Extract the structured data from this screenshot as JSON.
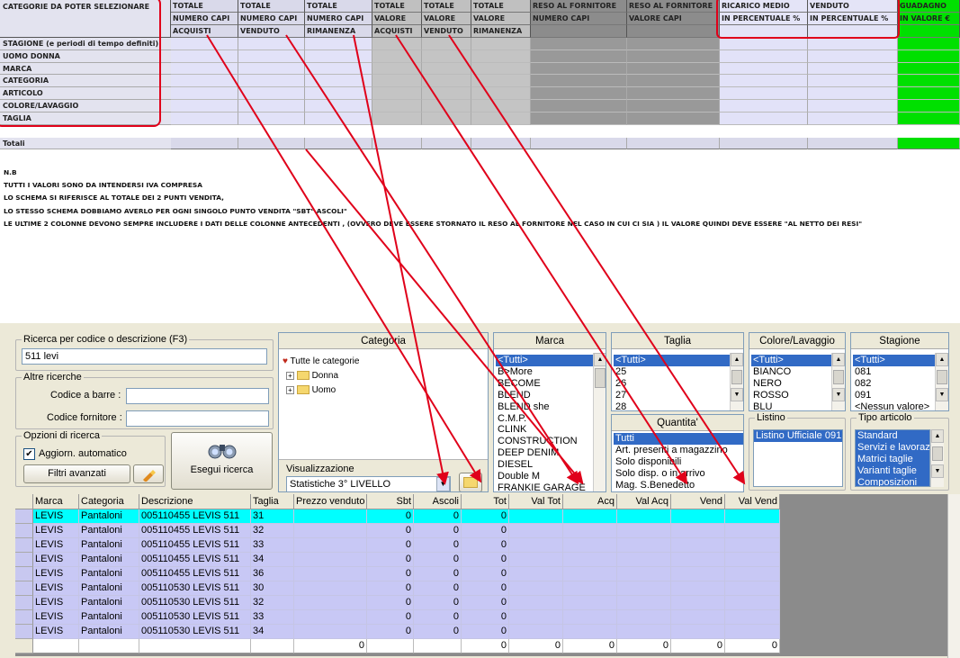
{
  "sheet": {
    "header_label": "CATEGORIE DA POTER SELEZIONARE",
    "columns": [
      {
        "l1": "TOTALE",
        "l2": "NUMERO CAPI",
        "l3": "ACQUISTI"
      },
      {
        "l1": "TOTALE",
        "l2": "NUMERO CAPI",
        "l3": "VENDUTO"
      },
      {
        "l1": "TOTALE",
        "l2": "NUMERO CAPI",
        "l3": "RIMANENZA"
      },
      {
        "l1": "TOTALE",
        "l2": "VALORE",
        "l3": "ACQUISTI"
      },
      {
        "l1": "TOTALE",
        "l2": "VALORE",
        "l3": "VENDUTO"
      },
      {
        "l1": "TOTALE",
        "l2": "VALORE",
        "l3": "RIMANENZA"
      },
      {
        "l1": "RESO AL FORNITORE",
        "l2": "NUMERO CAPI",
        "l3": ""
      },
      {
        "l1": "RESO AL FORNITORE",
        "l2": "VALORE CAPI",
        "l3": ""
      },
      {
        "l1": "RICARICO MEDIO",
        "l2": "IN PERCENTUALE %",
        "l3": ""
      },
      {
        "l1": "VENDUTO",
        "l2": "IN PERCENTUALE %",
        "l3": ""
      },
      {
        "l1": "GUADAGNO",
        "l2": "IN VALORE €",
        "l3": ""
      }
    ],
    "rows": [
      "STAGIONE (e periodi di tempo definiti)",
      "UOMO DONNA",
      "MARCA",
      "CATEGORIA",
      "ARTICOLO",
      "COLORE/LAVAGGIO",
      "TAGLIA"
    ],
    "total_label": "Totali",
    "notes": [
      "N.B",
      "TUTTI I VALORI SONO DA INTENDERSI IVA COMPRESA",
      "LO SCHEMA SI RIFERISCE AL TOTALE DEI 2 PUNTI VENDITA,",
      "LO STESSO SCHEMA DOBBIAMO AVERLO PER OGNI SINGOLO PUNTO VENDITA \"SBT\" ASCOLI\"",
      "LE ULTIME 2 COLONNE DEVONO SEMPRE INCLUDERE I DATI DELLE COLONNE ANTECEDENTI , (OVVERO DEVE ESSERE STORNATO IL RESO AL FORNITORE NEL CASO IN CUI CI SIA ) IL VALORE QUINDI DEVE ESSERE \"AL NETTO DEI RESI\""
    ]
  },
  "search": {
    "title": "Ricerca per codice o descrizione (F3)",
    "value": "511 levi",
    "other_title": "Altre ricerche",
    "barcode_label": "Codice a barre :",
    "supplier_label": "Codice fornitore :",
    "options_title": "Opzioni di ricerca",
    "auto_update_label": "Aggiorn. automatico",
    "advanced_filters": "Filtri avanzati",
    "run_search": "Esegui ricerca"
  },
  "categoria": {
    "title": "Categoria",
    "root": "Tutte le categorie",
    "children": [
      "Donna",
      "Uomo"
    ],
    "view_title": "Visualizzazione",
    "view_value": "Statistiche 3° LIVELLO"
  },
  "marca": {
    "title": "Marca",
    "items": [
      "<Tutti>",
      "B>More",
      "BECOME",
      "BLEND",
      "BLEND she",
      "C.M.P.",
      "CLINK",
      "CONSTRUCTION",
      "DEEP DENIM",
      "DIESEL",
      "Double M",
      "FRANKIE GARAGE"
    ]
  },
  "taglia": {
    "title": "Taglia",
    "items": [
      "<Tutti>",
      "25",
      "26",
      "27",
      "28"
    ]
  },
  "quantita": {
    "title": "Quantita'",
    "items": [
      "Tutti",
      "Art. presenti a magazzino",
      "Solo disponibili",
      "Solo disp. o in arrivo",
      "Mag. S.Benedetto"
    ]
  },
  "colore": {
    "title": "Colore/Lavaggio",
    "items": [
      "<Tutti>",
      "BIANCO",
      "NERO",
      "ROSSO",
      "BLU"
    ]
  },
  "listino": {
    "title": "Listino",
    "items": [
      "Listino Ufficiale 091"
    ]
  },
  "stagione": {
    "title": "Stagione",
    "items": [
      "<Tutti>",
      "081",
      "082",
      "091",
      "<Nessun valore>"
    ]
  },
  "tipo": {
    "title": "Tipo articolo",
    "items": [
      "Standard",
      "Servizi e lavorazioni",
      "Matrici taglie",
      "Varianti taglie",
      "Composizioni"
    ]
  },
  "grid": {
    "headers": [
      "Marca",
      "Categoria",
      "Descrizione",
      "Taglia",
      "Prezzo venduto",
      "Sbt",
      "Ascoli",
      "Tot",
      "Val Tot",
      "Acq",
      "Val Acq",
      "Vend",
      "Val Vend"
    ],
    "rows": [
      [
        "LEVIS",
        "Pantaloni",
        "005110455 LEVIS 511",
        "31",
        "",
        "0",
        "0",
        "0",
        "",
        "",
        "",
        "",
        ""
      ],
      [
        "LEVIS",
        "Pantaloni",
        "005110455 LEVIS 511",
        "32",
        "",
        "0",
        "0",
        "0",
        "",
        "",
        "",
        "",
        ""
      ],
      [
        "LEVIS",
        "Pantaloni",
        "005110455 LEVIS 511",
        "33",
        "",
        "0",
        "0",
        "0",
        "",
        "",
        "",
        "",
        ""
      ],
      [
        "LEVIS",
        "Pantaloni",
        "005110455 LEVIS 511",
        "34",
        "",
        "0",
        "0",
        "0",
        "",
        "",
        "",
        "",
        ""
      ],
      [
        "LEVIS",
        "Pantaloni",
        "005110455 LEVIS 511",
        "36",
        "",
        "0",
        "0",
        "0",
        "",
        "",
        "",
        "",
        ""
      ],
      [
        "LEVIS",
        "Pantaloni",
        "005110530 LEVIS 511",
        "30",
        "",
        "0",
        "0",
        "0",
        "",
        "",
        "",
        "",
        ""
      ],
      [
        "LEVIS",
        "Pantaloni",
        "005110530 LEVIS 511",
        "32",
        "",
        "0",
        "0",
        "0",
        "",
        "",
        "",
        "",
        ""
      ],
      [
        "LEVIS",
        "Pantaloni",
        "005110530 LEVIS 511",
        "33",
        "",
        "0",
        "0",
        "0",
        "",
        "",
        "",
        "",
        ""
      ],
      [
        "LEVIS",
        "Pantaloni",
        "005110530 LEVIS 511",
        "34",
        "",
        "0",
        "0",
        "0",
        "",
        "",
        "",
        "",
        ""
      ]
    ],
    "totals": [
      "",
      "",
      "",
      "",
      "0",
      "",
      "",
      "0",
      "0",
      "0",
      "0",
      "0",
      "0"
    ]
  },
  "colors": {
    "selected": "#316ac5",
    "row_highlight": "#00ffff",
    "row_bg": "#c8c8f5",
    "arrow": "#e0001a",
    "green": "#00e000"
  }
}
